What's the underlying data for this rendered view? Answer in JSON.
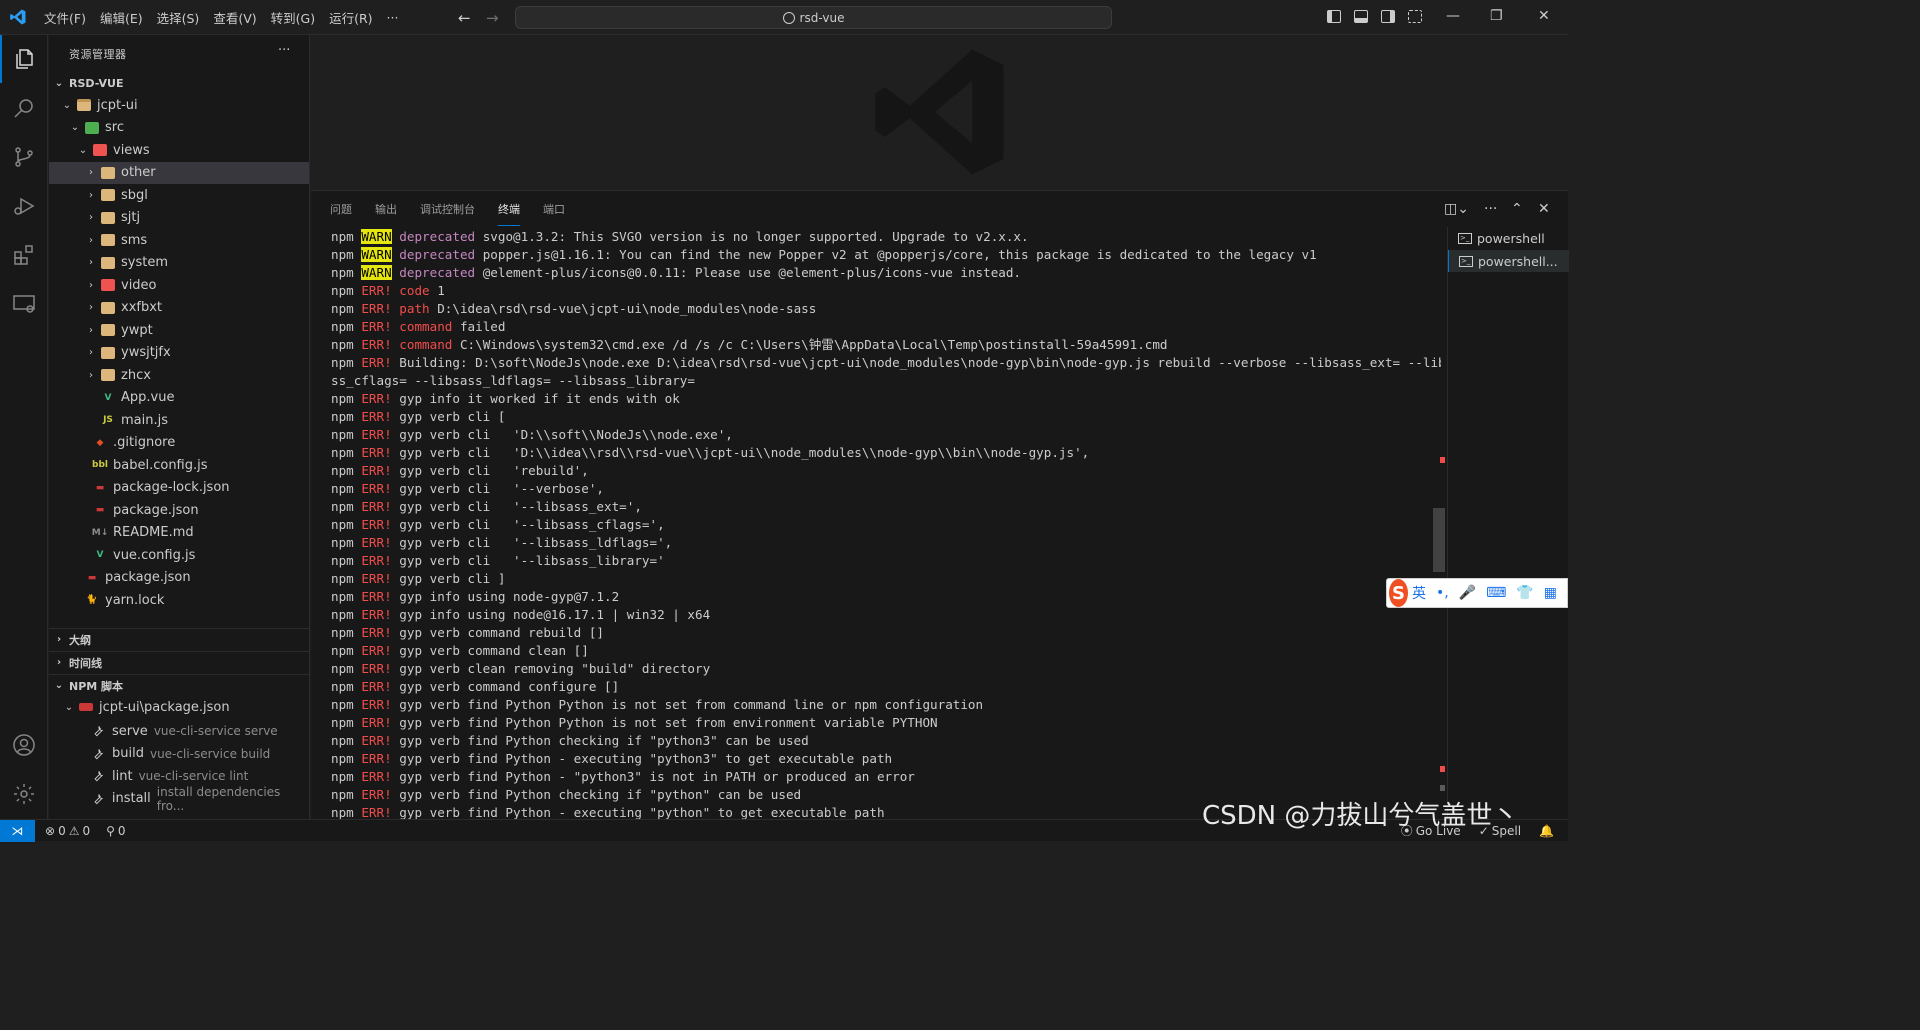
{
  "titlebar": {
    "menu": [
      "文件(F)",
      "编辑(E)",
      "选择(S)",
      "查看(V)",
      "转到(G)",
      "运行(R)",
      "···"
    ],
    "search_text": "rsd-vue",
    "back": "←",
    "forward": "→",
    "min": "—",
    "restore": "❐",
    "close": "✕"
  },
  "sidebar": {
    "title": "资源管理器",
    "more": "···",
    "root": "RSD-VUE",
    "tree": [
      {
        "label": "jcpt-ui",
        "indent": 1,
        "chev": "open",
        "icon": "folder-open"
      },
      {
        "label": "src",
        "indent": 2,
        "chev": "open",
        "icon": "src-folder"
      },
      {
        "label": "views",
        "indent": 3,
        "chev": "open",
        "icon": "views-folder"
      },
      {
        "label": "other",
        "indent": 4,
        "chev": "closed",
        "icon": "folder",
        "selected": true
      },
      {
        "label": "sbgl",
        "indent": 4,
        "chev": "closed",
        "icon": "folder"
      },
      {
        "label": "sjtj",
        "indent": 4,
        "chev": "closed",
        "icon": "folder"
      },
      {
        "label": "sms",
        "indent": 4,
        "chev": "closed",
        "icon": "folder"
      },
      {
        "label": "system",
        "indent": 4,
        "chev": "closed",
        "icon": "folder"
      },
      {
        "label": "video",
        "indent": 4,
        "chev": "closed",
        "icon": "views-folder"
      },
      {
        "label": "xxfbxt",
        "indent": 4,
        "chev": "closed",
        "icon": "folder"
      },
      {
        "label": "ywpt",
        "indent": 4,
        "chev": "closed",
        "icon": "folder"
      },
      {
        "label": "ywsjtjfx",
        "indent": 4,
        "chev": "closed",
        "icon": "folder"
      },
      {
        "label": "zhcx",
        "indent": 4,
        "chev": "closed",
        "icon": "folder"
      },
      {
        "label": "App.vue",
        "indent": 4,
        "chev": "none",
        "icon": "vue"
      },
      {
        "label": "main.js",
        "indent": 4,
        "chev": "none",
        "icon": "js"
      },
      {
        "label": ".gitignore",
        "indent": 3,
        "chev": "none",
        "icon": "git"
      },
      {
        "label": "babel.config.js",
        "indent": 3,
        "chev": "none",
        "icon": "babel"
      },
      {
        "label": "package-lock.json",
        "indent": 3,
        "chev": "none",
        "icon": "npm"
      },
      {
        "label": "package.json",
        "indent": 3,
        "chev": "none",
        "icon": "npm"
      },
      {
        "label": "README.md",
        "indent": 3,
        "chev": "none",
        "icon": "md"
      },
      {
        "label": "vue.config.js",
        "indent": 3,
        "chev": "none",
        "icon": "vue"
      },
      {
        "label": "package.json",
        "indent": 2,
        "chev": "none",
        "icon": "npm"
      },
      {
        "label": "yarn.lock",
        "indent": 2,
        "chev": "none",
        "icon": "yarn"
      }
    ],
    "sections": [
      "大纲",
      "时间线",
      "NPM 脚本"
    ],
    "npm_package": "jcpt-ui\\package.json",
    "npm_scripts": [
      {
        "name": "serve",
        "cmd": "vue-cli-service serve"
      },
      {
        "name": "build",
        "cmd": "vue-cli-service build"
      },
      {
        "name": "lint",
        "cmd": "vue-cli-service lint"
      },
      {
        "name": "install",
        "cmd": "install dependencies fro..."
      }
    ]
  },
  "panel": {
    "tabs": [
      "问题",
      "输出",
      "调试控制台",
      "终端",
      "端口"
    ],
    "active_tab": "终端",
    "terminals": [
      "powershell",
      "powershell..."
    ],
    "lines": [
      [
        "npm ",
        "WARN",
        " ",
        "deprecated",
        " svgo@1.3.2: This SVGO version is no longer supported. Upgrade to v2.x.x."
      ],
      [
        "npm ",
        "WARN",
        " ",
        "deprecated",
        " popper.js@1.16.1: You can find the new Popper v2 at @popperjs/core, this package is dedicated to the legacy v1"
      ],
      [
        "npm ",
        "WARN",
        " ",
        "deprecated",
        " @element-plus/icons@0.0.11: Please use @element-plus/icons-vue instead."
      ],
      [
        "npm ",
        "ERR!",
        " ",
        "code",
        " 1"
      ],
      [
        "npm ",
        "ERR!",
        " ",
        "path",
        " D:\\idea\\rsd\\rsd-vue\\jcpt-ui\\node_modules\\node-sass"
      ],
      [
        "npm ",
        "ERR!",
        " ",
        "command",
        " failed"
      ],
      [
        "npm ",
        "ERR!",
        " ",
        "command",
        " C:\\Windows\\system32\\cmd.exe /d /s /c C:\\Users\\钟雷\\AppData\\Local\\Temp\\postinstall-59a45991.cmd"
      ],
      [
        "npm ",
        "ERR!",
        " ",
        "",
        "Building: D:\\soft\\NodeJs\\node.exe D:\\idea\\rsd\\rsd-vue\\jcpt-ui\\node_modules\\node-gyp\\bin\\node-gyp.js rebuild --verbose --libsass_ext= --libsa"
      ],
      [
        "",
        "",
        "",
        "",
        "ss_cflags= --libsass_ldflags= --libsass_library="
      ],
      [
        "npm ",
        "ERR!",
        " ",
        "",
        "gyp info it worked if it ends with ok"
      ],
      [
        "npm ",
        "ERR!",
        " ",
        "",
        "gyp verb cli ["
      ],
      [
        "npm ",
        "ERR!",
        " ",
        "",
        "gyp verb cli   'D:\\\\soft\\\\NodeJs\\\\node.exe',"
      ],
      [
        "npm ",
        "ERR!",
        " ",
        "",
        "gyp verb cli   'D:\\\\idea\\\\rsd\\\\rsd-vue\\\\jcpt-ui\\\\node_modules\\\\node-gyp\\\\bin\\\\node-gyp.js',"
      ],
      [
        "npm ",
        "ERR!",
        " ",
        "",
        "gyp verb cli   'rebuild',"
      ],
      [
        "npm ",
        "ERR!",
        " ",
        "",
        "gyp verb cli   '--verbose',"
      ],
      [
        "npm ",
        "ERR!",
        " ",
        "",
        "gyp verb cli   '--libsass_ext=',"
      ],
      [
        "npm ",
        "ERR!",
        " ",
        "",
        "gyp verb cli   '--libsass_cflags=',"
      ],
      [
        "npm ",
        "ERR!",
        " ",
        "",
        "gyp verb cli   '--libsass_ldflags=',"
      ],
      [
        "npm ",
        "ERR!",
        " ",
        "",
        "gyp verb cli   '--libsass_library='"
      ],
      [
        "npm ",
        "ERR!",
        " ",
        "",
        "gyp verb cli ]"
      ],
      [
        "npm ",
        "ERR!",
        " ",
        "",
        "gyp info using node-gyp@7.1.2"
      ],
      [
        "npm ",
        "ERR!",
        " ",
        "",
        "gyp info using node@16.17.1 | win32 | x64"
      ],
      [
        "npm ",
        "ERR!",
        " ",
        "",
        "gyp verb command rebuild []"
      ],
      [
        "npm ",
        "ERR!",
        " ",
        "",
        "gyp verb command clean []"
      ],
      [
        "npm ",
        "ERR!",
        " ",
        "",
        "gyp verb clean removing \"build\" directory"
      ],
      [
        "npm ",
        "ERR!",
        " ",
        "",
        "gyp verb command configure []"
      ],
      [
        "npm ",
        "ERR!",
        " ",
        "",
        "gyp verb find Python Python is not set from command line or npm configuration"
      ],
      [
        "npm ",
        "ERR!",
        " ",
        "",
        "gyp verb find Python Python is not set from environment variable PYTHON"
      ],
      [
        "npm ",
        "ERR!",
        " ",
        "",
        "gyp verb find Python checking if \"python3\" can be used"
      ],
      [
        "npm ",
        "ERR!",
        " ",
        "",
        "gyp verb find Python - executing \"python3\" to get executable path"
      ],
      [
        "npm ",
        "ERR!",
        " ",
        "",
        "gyp verb find Python - \"python3\" is not in PATH or produced an error"
      ],
      [
        "npm ",
        "ERR!",
        " ",
        "",
        "gyp verb find Python checking if \"python\" can be used"
      ],
      [
        "npm ",
        "ERR!",
        " ",
        "",
        "gyp verb find Python - executing \"python\" to get executable path"
      ]
    ]
  },
  "ime": {
    "lang": "英",
    "punct": "•,",
    "mic": "🎤",
    "kbd": "⌨",
    "skin": "👕",
    "apps": "▦"
  },
  "statusbar": {
    "remote": "⋊",
    "errors": "0",
    "warnings": "0",
    "ports": "0",
    "go_live": "Go Live",
    "spell": "Spell"
  },
  "watermark": "CSDN @力拔山兮气盖世丶"
}
